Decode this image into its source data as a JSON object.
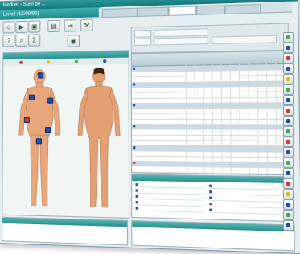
{
  "window": {
    "title": "Mediter - Suivi de ...",
    "subtitle": "Lionel (13/09/95)"
  },
  "toolbar": {
    "buttons": [
      {
        "icon": "patient-icon",
        "glyph": "☺"
      },
      {
        "icon": "next-icon",
        "glyph": "▶"
      },
      {
        "icon": "camera-icon",
        "glyph": "▣"
      },
      {
        "icon": "folder-icon",
        "glyph": "▤"
      },
      {
        "icon": "exit-icon",
        "glyph": "⇥"
      },
      {
        "icon": "tools-icon",
        "glyph": "⚒"
      },
      {
        "icon": "help-icon",
        "glyph": "?"
      },
      {
        "icon": "search-icon",
        "glyph": "⌕"
      },
      {
        "icon": "sum-icon",
        "glyph": "Σ"
      },
      {
        "icon": "eye-icon",
        "glyph": "◉"
      }
    ]
  },
  "colors": {
    "teal": "#2c8f8f",
    "skin": "#e7a77a",
    "marker_blue": "#1e4fb8",
    "marker_red": "#d23b2f",
    "group_row": "#ccdbe3"
  },
  "body_map": {
    "legend_colors": [
      "#d23b2f",
      "#e6c300",
      "#3fae49",
      "#1e4fb8"
    ]
  },
  "grid": {
    "rows": [
      {
        "group": true,
        "icon": "#1e4fb8"
      },
      {
        "group": false
      },
      {
        "group": false
      },
      {
        "group": true,
        "icon": "#1e4fb8"
      },
      {
        "group": false
      },
      {
        "group": false
      },
      {
        "group": false
      },
      {
        "group": true,
        "icon": "#1e4fb8"
      },
      {
        "group": false
      },
      {
        "group": false
      },
      {
        "group": false
      },
      {
        "group": true,
        "icon": "#1e4fb8"
      },
      {
        "group": false
      },
      {
        "group": false
      },
      {
        "group": false
      },
      {
        "group": true,
        "icon": "#1e4fb8"
      },
      {
        "group": false
      },
      {
        "group": false
      },
      {
        "group": true,
        "icon": "#d23b2f"
      },
      {
        "group": false
      }
    ]
  },
  "lower_list": {
    "rows": 5
  }
}
